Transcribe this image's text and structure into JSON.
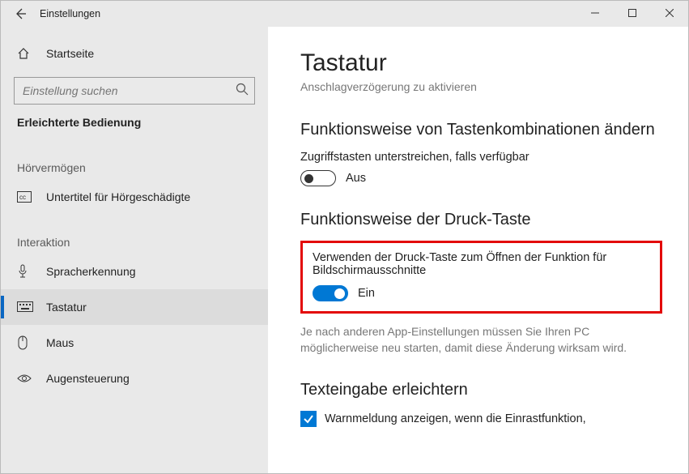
{
  "titlebar": {
    "title": "Einstellungen"
  },
  "sidebar": {
    "home_label": "Startseite",
    "search_placeholder": "Einstellung suchen",
    "section": "Erleichterte Bedienung",
    "group1_label": "Hörvermögen",
    "item_cc": "Untertitel für Hörgeschädigte",
    "group2_label": "Interaktion",
    "item_speech": "Spracherkennung",
    "item_keyboard": "Tastatur",
    "item_mouse": "Maus",
    "item_eye": "Augensteuerung"
  },
  "content": {
    "title": "Tastatur",
    "subtitle": "Anschlagverzögerung zu aktivieren",
    "section_shortcuts": "Funktionsweise von Tastenkombinationen ändern",
    "opt_underline": "Zugriffstasten unterstreichen, falls verfügbar",
    "toggle_off": "Aus",
    "section_print": "Funktionsweise der Druck-Taste",
    "opt_print": "Verwenden der Druck-Taste zum Öffnen der Funktion für Bildschirmausschnitte",
    "toggle_on": "Ein",
    "print_note": "Je nach anderen App-Einstellungen müssen Sie Ihren PC möglicherweise neu starten, damit diese Änderung wirksam wird.",
    "section_text": "Texteingabe erleichtern",
    "check_warn": "Warnmeldung anzeigen, wenn die Einrastfunktion,"
  }
}
